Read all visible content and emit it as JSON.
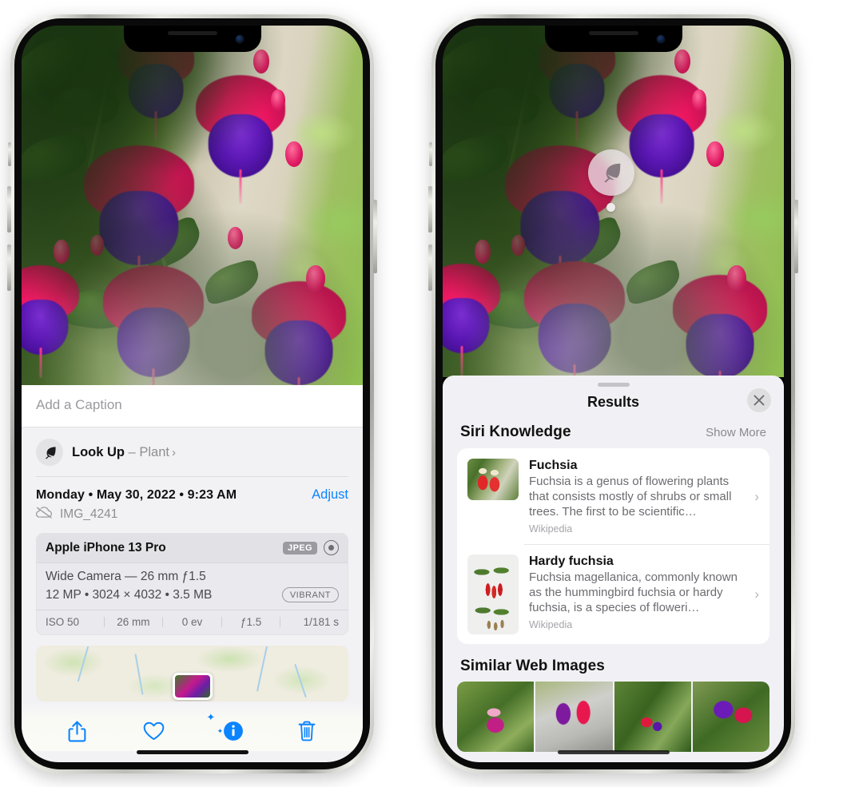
{
  "left_phone": {
    "caption": {
      "value": "",
      "placeholder": "Add a Caption"
    },
    "lookup": {
      "icon": "leaf-icon",
      "label": "Look Up",
      "separator": " – ",
      "subject": "Plant",
      "chevron": "›"
    },
    "metadata": {
      "date_line": "Monday • May 30, 2022 • 9:23 AM",
      "adjust_label": "Adjust",
      "cloud_icon": "icloud-slash-icon",
      "filename": "IMG_4241"
    },
    "camera": {
      "model": "Apple iPhone 13 Pro",
      "format_badge": "JPEG",
      "raw_icon": "raw-aperture-icon",
      "lens": "Wide Camera — 26 mm ƒ1.5",
      "specs": "12 MP • 3024 × 4032 • 3.5 MB",
      "style_badge": "VIBRANT",
      "exif": [
        "ISO 50",
        "26 mm",
        "0 ev",
        "ƒ1.5",
        "1/181 s"
      ]
    },
    "map": {
      "name": "photo-location-map"
    },
    "toolbar": [
      {
        "name": "share-button",
        "icon": "share-icon"
      },
      {
        "name": "favorite-button",
        "icon": "heart-icon"
      },
      {
        "name": "info-button",
        "icon": "info-sparkle-icon"
      },
      {
        "name": "delete-button",
        "icon": "trash-icon"
      }
    ]
  },
  "right_phone": {
    "badge": {
      "icon": "leaf-icon"
    },
    "sheet": {
      "title": "Results",
      "close_icon": "close-icon",
      "sections": [
        {
          "title": "Siri Knowledge",
          "action": "Show More",
          "cards": [
            {
              "title": "Fuchsia",
              "description": "Fuchsia is a genus of flowering plants that consists mostly of shrubs or small trees. The first to be scientific…",
              "source": "Wikipedia",
              "thumb": "fuchsia-red-flowers-thumbnail",
              "chevron": "›"
            },
            {
              "title": "Hardy fuchsia",
              "description": "Fuchsia magellanica, commonly known as the hummingbird fuchsia or hardy fuchsia, is a species of floweri…",
              "source": "Wikipedia",
              "thumb": "hardy-fuchsia-specimen-thumbnail",
              "chevron": "›"
            }
          ]
        },
        {
          "title": "Similar Web Images",
          "images": [
            "web-image-magenta-fuchsia",
            "web-image-red-purple-fuchsia",
            "web-image-fuchsia-bush",
            "web-image-purple-fuchsia-cluster"
          ]
        }
      ]
    }
  },
  "colors": {
    "accent_blue": "#0a84ff",
    "sheet_bg": "#f1f1f5",
    "card_bg": "#ffffff",
    "secondary_text": "#8e8e93"
  }
}
